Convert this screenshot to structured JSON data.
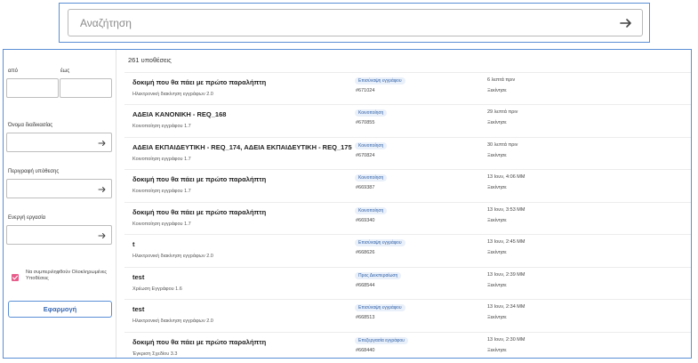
{
  "search": {
    "placeholder": "Αναζήτηση"
  },
  "filters": {
    "from_label": "από",
    "to_label": "έως",
    "process_name_label": "Όνομα διαδικασίας",
    "case_description_label": "Περιγραφή υπόθεσης",
    "active_task_label": "Ενεργή εργασία",
    "include_completed_label": "Να συμπεριληφθούν Ολοκληρωμένες Υποθέσεις",
    "include_completed_checked": true,
    "apply_label": "Εφαρμογή"
  },
  "results": {
    "count_label": "261 υποθέσεις",
    "rows": [
      {
        "title": "δοκιμή που θα πάει με πρώτο παραλήπτη",
        "process": "Ηλεκτρονική διακίνηση εγγράφων 2.0",
        "task": "Επισύναψη εγγράφου",
        "number": "#671024",
        "time": "6 λεπτά πριν",
        "status": "Ξεκίνησε"
      },
      {
        "title": "ΑΔΕΙΑ ΚΑΝΟΝΙΚΗ - REQ_168",
        "process": "Κοινοποίηση εγγράφου 1.7",
        "task": "Κοινοποίηση",
        "number": "#670855",
        "time": "29 λεπτά πριν",
        "status": "Ξεκίνησε"
      },
      {
        "title": "ΑΔΕΙΑ ΕΚΠΑΙΔΕΥΤΙΚΗ - REQ_174, ΑΔΕΙΑ ΕΚΠΑΙΔΕΥΤΙΚΗ - REQ_175",
        "process": "Κοινοποίηση εγγράφου 1.7",
        "task": "Κοινοποίηση",
        "number": "#670824",
        "time": "30 λεπτά πριν",
        "status": "Ξεκίνησε"
      },
      {
        "title": "δοκιμή που θα πάει με πρώτο παραλήπτη",
        "process": "Κοινοποίηση εγγράφου 1.7",
        "task": "Κοινοποίηση",
        "number": "#669387",
        "time": "13 Ιουν, 4:06 ΜΜ",
        "status": "Ξεκίνησε"
      },
      {
        "title": "δοκιμή που θα πάει με πρώτο παραλήπτη",
        "process": "Κοινοποίηση εγγράφου 1.7",
        "task": "Κοινοποίηση",
        "number": "#669340",
        "time": "13 Ιουν, 3:53 ΜΜ",
        "status": "Ξεκίνησε"
      },
      {
        "title": "t",
        "process": "Ηλεκτρονική διακίνηση εγγράφων 2.0",
        "task": "Επισύναψη εγγράφου",
        "number": "#668626",
        "time": "13 Ιουν, 2:45 ΜΜ",
        "status": "Ξεκίνησε"
      },
      {
        "title": "test",
        "process": "Χρέωση Εγγράφου 1.6",
        "task": "Προς Διεκπεραίωση",
        "number": "#668544",
        "time": "13 Ιουν, 2:39 ΜΜ",
        "status": "Ξεκίνησε"
      },
      {
        "title": "test",
        "process": "Ηλεκτρονική διακίνηση εγγράφων 2.0",
        "task": "Επισύναψη εγγράφου",
        "number": "#668513",
        "time": "13 Ιουν, 2:34 ΜΜ",
        "status": "Ξεκίνησε"
      },
      {
        "title": "δοκιμή που θα πάει με πρώτο παραλήπτη",
        "process": "Έγκριση Σχεδίου 3.3",
        "task": "Επεξεργασία εγγράφου",
        "number": "#668440",
        "time": "13 Ιουν, 2:30 ΜΜ",
        "status": "Ξεκίνησε"
      }
    ]
  },
  "colors": {
    "accent": "#5b8fd6",
    "checkbox": "#e65c8b",
    "badge_bg": "#e9f0fa",
    "badge_text": "#2d5fa7"
  },
  "icons": {
    "search_submit": "arrow-right-icon",
    "field_submit": "arrow-right-icon",
    "checkbox": "check-icon"
  }
}
